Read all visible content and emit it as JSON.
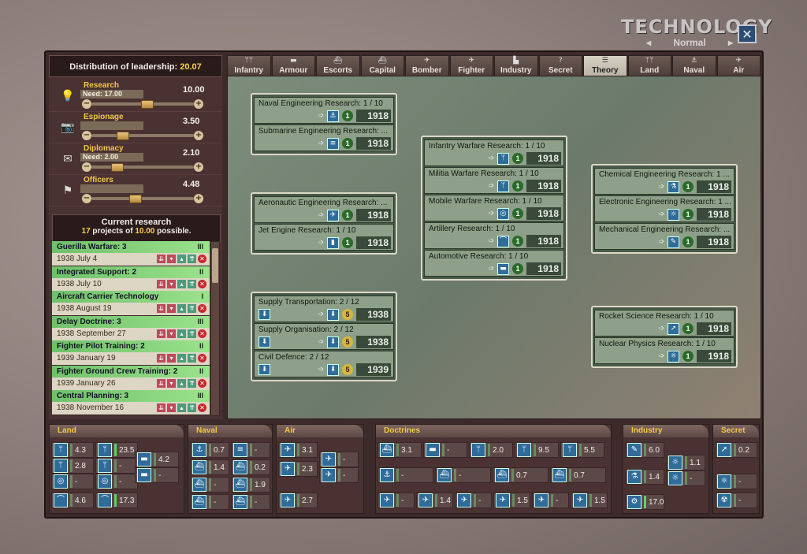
{
  "header": {
    "title": "TECHNOLOGY",
    "difficulty": "Normal",
    "close_label": "✕"
  },
  "leadership": {
    "title": "Distribution of leadership:",
    "total": "20.07",
    "rows": [
      {
        "label": "Research",
        "need": "Need: 17.00",
        "value": "10.00",
        "icon": "lightbulb-icon",
        "glyph": "💡"
      },
      {
        "label": "Espionage",
        "need": "",
        "value": "3.50",
        "icon": "camera-icon",
        "glyph": "📷"
      },
      {
        "label": "Diplomacy",
        "need": "Need: 2.00",
        "value": "2.10",
        "icon": "envelope-icon",
        "glyph": "✉"
      },
      {
        "label": "Officers",
        "need": "",
        "value": "4.48",
        "icon": "flag-icon",
        "glyph": "⚑"
      }
    ],
    "levels": [
      0.55,
      0.28,
      0.22,
      0.42
    ]
  },
  "current_research": {
    "title": "Current research",
    "count": "17",
    "mid": " projects of ",
    "possible": "10.00",
    "tail": " possible.",
    "items": [
      {
        "name": "Guerilla Warfare: 3",
        "date": "1938 July 4",
        "level": "III"
      },
      {
        "name": "Integrated Support: 2",
        "date": "1938 July 10",
        "level": "II"
      },
      {
        "name": "Aircraft Carrier Technology",
        "date": "1938 August 19",
        "level": "I"
      },
      {
        "name": "Delay Doctrine: 3",
        "date": "1938 September 27",
        "level": "III"
      },
      {
        "name": "Fighter Pilot Training: 2",
        "date": "1939 January 19",
        "level": "II"
      },
      {
        "name": "Fighter Ground Crew Training: 2",
        "date": "1939 January 26",
        "level": "II"
      },
      {
        "name": "Central Planning: 3",
        "date": "1938 November 16",
        "level": "III"
      }
    ]
  },
  "tabs": [
    {
      "label": "Infantry",
      "glyph": "ᛘᛘ"
    },
    {
      "label": "Armour",
      "glyph": "▬"
    },
    {
      "label": "Escorts",
      "glyph": "⛴"
    },
    {
      "label": "Capital",
      "glyph": "⛴"
    },
    {
      "label": "Bomber",
      "glyph": "✈"
    },
    {
      "label": "Fighter",
      "glyph": "✈"
    },
    {
      "label": "Industry",
      "glyph": "▙"
    },
    {
      "label": "Secret",
      "glyph": "?"
    },
    {
      "label": "Theory",
      "glyph": "☰",
      "active": true
    },
    {
      "label": "Land",
      "glyph": "ᛘᛘ"
    },
    {
      "label": "Naval",
      "glyph": "⚓"
    },
    {
      "label": "Air",
      "glyph": "✈"
    }
  ],
  "tech_groups": [
    {
      "techs": [
        {
          "name": "Naval Engineering Research: 1 / 10",
          "icon": "⚓",
          "badge": "1",
          "year": "1918"
        },
        {
          "name": "Submarine Engineering Research: ...",
          "icon": "≡",
          "badge": "1",
          "year": "1918"
        }
      ]
    },
    {
      "techs": [
        {
          "name": "Aeronautic Engineering Research: ...",
          "icon": "✈",
          "badge": "1",
          "year": "1918"
        },
        {
          "name": "Jet Engine Research: 1 / 10",
          "icon": "▮",
          "badge": "1",
          "year": "1918"
        }
      ]
    },
    {
      "techs": [
        {
          "name": "Supply Transportation: 2 / 12",
          "icon": "⬇",
          "badge": "5",
          "year": "1938",
          "left": "⬇"
        },
        {
          "name": "Supply Organisation: 2 / 12",
          "icon": "⬇",
          "badge": "5",
          "year": "1938",
          "left": "⬇"
        },
        {
          "name": "Civil Defence: 2 / 12",
          "icon": "⬇",
          "badge": "5",
          "year": "1939",
          "left": "⬇"
        }
      ]
    },
    {
      "techs": [
        {
          "name": "Infantry Warfare Research: 1 / 10",
          "icon": "ᛘ",
          "badge": "1",
          "year": "1918"
        },
        {
          "name": "Militia Warfare Research: 1 / 10",
          "icon": "ᛘ",
          "badge": "1",
          "year": "1918"
        },
        {
          "name": "Mobile Warfare Research: 1 / 10",
          "icon": "◎",
          "badge": "1",
          "year": "1918"
        },
        {
          "name": "Artillery Research: 1 / 10",
          "icon": "⌒",
          "badge": "1",
          "year": "1918"
        },
        {
          "name": "Automotive Research: 1 / 10",
          "icon": "▬",
          "badge": "1",
          "year": "1918"
        }
      ]
    },
    {
      "techs": [
        {
          "name": "Chemical Engineering Research: 1 ...",
          "icon": "⚗",
          "badge": "1",
          "year": "1918"
        },
        {
          "name": "Electronic Engineering Research: 1 ...",
          "icon": "☼",
          "badge": "1",
          "year": "1918"
        },
        {
          "name": "Mechanical Engineering Research: ...",
          "icon": "✎",
          "badge": "1",
          "year": "1918"
        }
      ]
    },
    {
      "techs": [
        {
          "name": "Rocket Science Research: 1 / 10",
          "icon": "➚",
          "badge": "1",
          "year": "1918"
        },
        {
          "name": "Nuclear Physics Research: 1 / 10",
          "icon": "⚛",
          "badge": "1",
          "year": "1918"
        }
      ]
    }
  ],
  "bottom": {
    "land": {
      "title": "Land",
      "cells": [
        {
          "g": "ᛘ",
          "v": "4.3"
        },
        {
          "g": "ᛘ",
          "v": "23.5"
        },
        {
          "g": "ᛘ",
          "v": "2.8"
        },
        {
          "g": "ᛘ",
          "v": "-"
        },
        {
          "g": "◎",
          "v": "-"
        },
        {
          "g": "◎",
          "v": "-"
        },
        {
          "g": "⌒",
          "v": "4.6"
        },
        {
          "g": "⌒",
          "v": "17.3"
        },
        {
          "g": "▬",
          "v": "4.2"
        },
        {
          "g": "▬",
          "v": "-"
        }
      ]
    },
    "naval": {
      "title": "Naval",
      "cells": [
        {
          "g": "⚓",
          "v": "0.7"
        },
        {
          "g": "≡",
          "v": "-"
        },
        {
          "g": "⛴",
          "v": "1.4"
        },
        {
          "g": "⛴",
          "v": "0.2"
        },
        {
          "g": "⛴",
          "v": "-"
        },
        {
          "g": "⛴",
          "v": "1.9"
        },
        {
          "g": "⛴",
          "v": "-"
        },
        {
          "g": "⛴",
          "v": "-"
        }
      ]
    },
    "air": {
      "title": "Air",
      "cells": [
        {
          "g": "✈",
          "v": "3.1"
        },
        {
          "g": "✈",
          "v": "2.3"
        },
        {
          "g": "✈",
          "v": "2.7"
        },
        {
          "g": "✈",
          "v": "-"
        },
        {
          "g": "✈",
          "v": "-"
        }
      ]
    },
    "doctrines": {
      "title": "Doctrines",
      "rows": [
        [
          {
            "g": "⛴",
            "v": "3.1"
          },
          {
            "g": "▬",
            "v": "-"
          },
          {
            "g": "ᛘ",
            "v": "2.0"
          },
          {
            "g": "ᛘ",
            "v": "9.5"
          },
          {
            "g": "ᛘ",
            "v": "5.5"
          }
        ],
        [
          {
            "g": "⚓",
            "v": "-"
          },
          {
            "g": "⛴",
            "v": "-"
          },
          {
            "g": "⛴",
            "v": "0.7"
          },
          {
            "g": "⛴",
            "v": "0.7"
          }
        ],
        [
          {
            "g": "✈",
            "v": "-"
          },
          {
            "g": "✈",
            "v": "1.4"
          },
          {
            "g": "✈",
            "v": "-"
          },
          {
            "g": "✈",
            "v": "1.5"
          },
          {
            "g": "✈",
            "v": "-"
          },
          {
            "g": "✈",
            "v": "1.5"
          }
        ]
      ]
    },
    "industry": {
      "title": "Industry",
      "cells": [
        {
          "g": "✎",
          "v": "6.0"
        },
        {
          "g": "⚗",
          "v": "1.4"
        },
        {
          "g": "⚙",
          "v": "17.0"
        },
        {
          "g": "☼",
          "v": "1.1"
        },
        {
          "g": "☼",
          "v": "-"
        }
      ]
    },
    "secret": {
      "title": "Secret",
      "cells": [
        {
          "g": "➚",
          "v": "0.2"
        },
        {
          "g": "⚛",
          "v": "-"
        },
        {
          "g": "☢",
          "v": "-"
        }
      ]
    }
  }
}
